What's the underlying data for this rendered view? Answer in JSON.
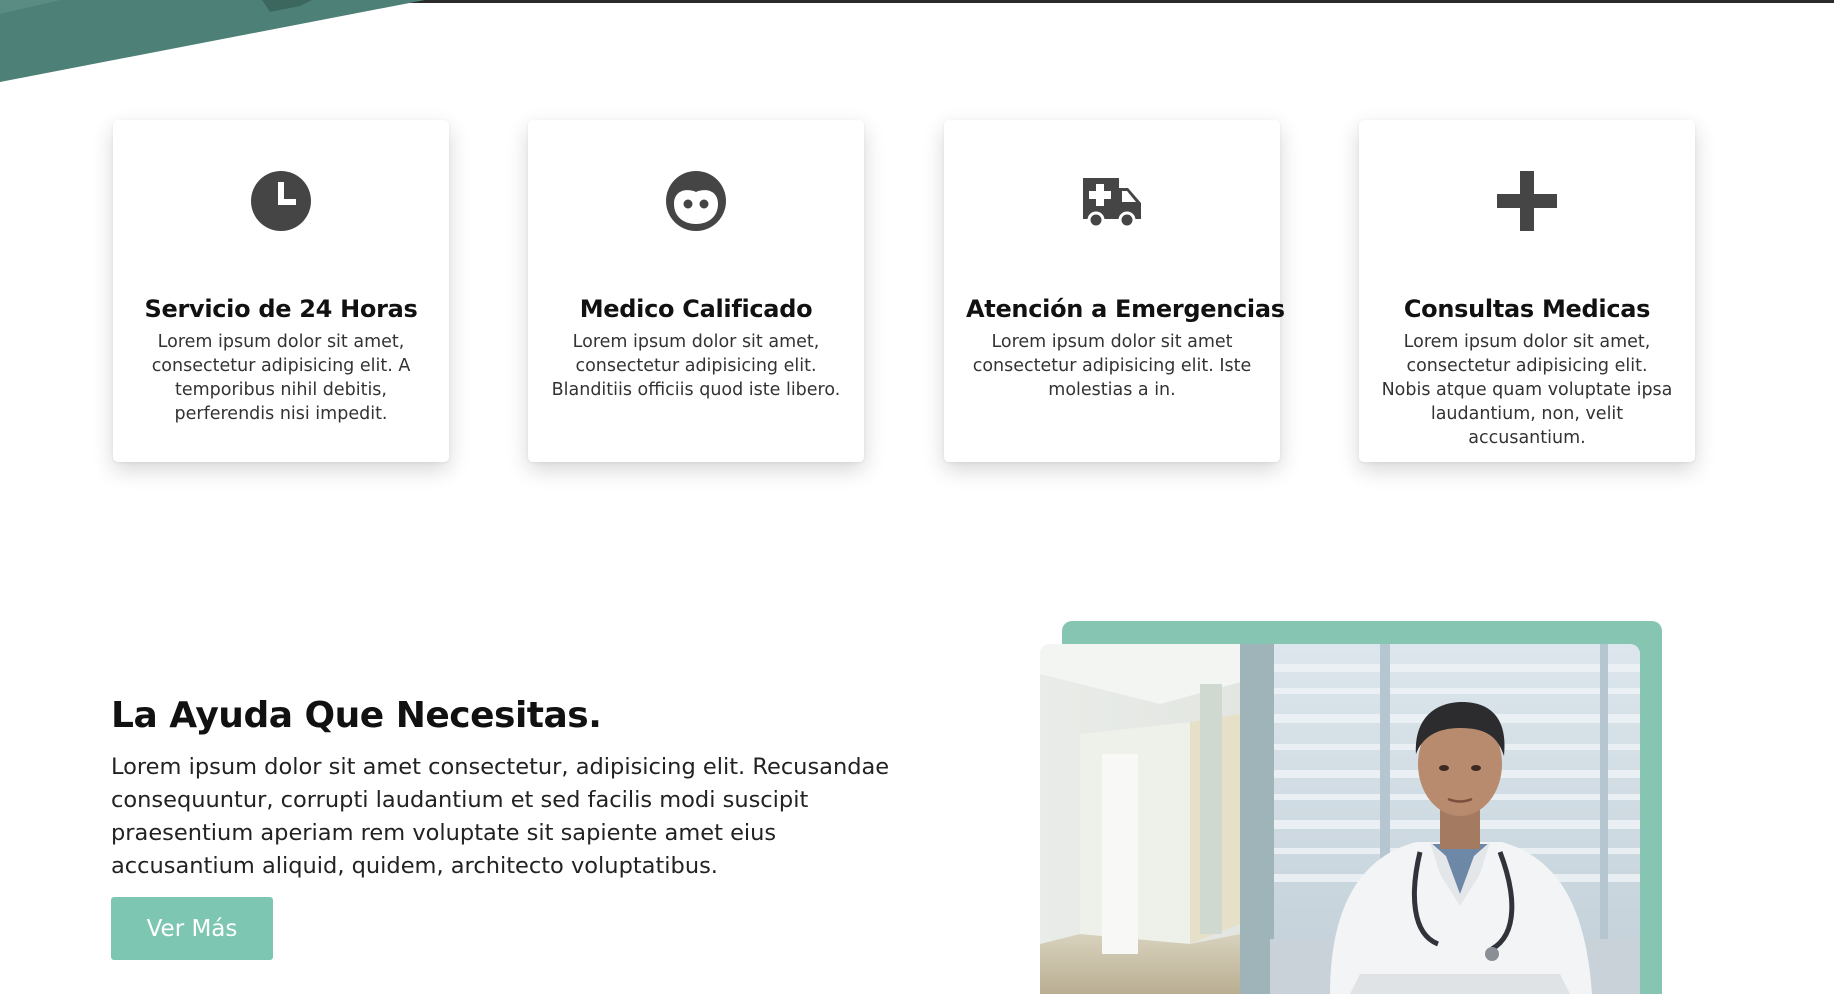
{
  "colors": {
    "accent": "#7dc6b1",
    "frame": "#86c5b2",
    "hero_teal": "#4d8077",
    "icon": "#454545"
  },
  "services": [
    {
      "icon": "clock-icon",
      "title": "Servicio de 24 Horas",
      "text": "Lorem ipsum dolor sit amet, consectetur adipisicing elit. A temporibus nihil debitis, perferendis nisi impedit."
    },
    {
      "icon": "smiley-face-icon",
      "title": "Medico Calificado",
      "text": "Lorem ipsum dolor sit amet, consectetur adipisicing elit. Blanditiis officiis quod iste libero."
    },
    {
      "icon": "ambulance-icon",
      "title": "Atención a Emergencias",
      "text": "Lorem ipsum dolor sit amet consectetur adipisicing elit. Iste molestias a in."
    },
    {
      "icon": "plus-icon",
      "title": "Consultas Medicas",
      "text": "Lorem ipsum dolor sit amet, consectetur adipisicing elit. Nobis atque quam voluptate ipsa laudantium, non, velit accusantium."
    }
  ],
  "about": {
    "title": "La Ayuda Que Necesitas.",
    "text": "Lorem ipsum dolor sit amet consectetur, adipisicing elit. Recusandae consequuntur, corrupti laudantium et sed facilis modi suscipit praesentium aperiam rem voluptate sit sapiente amet eius accusantium aliquid, quidem, architecto voluptatibus.",
    "button_label": "Ver Más"
  }
}
